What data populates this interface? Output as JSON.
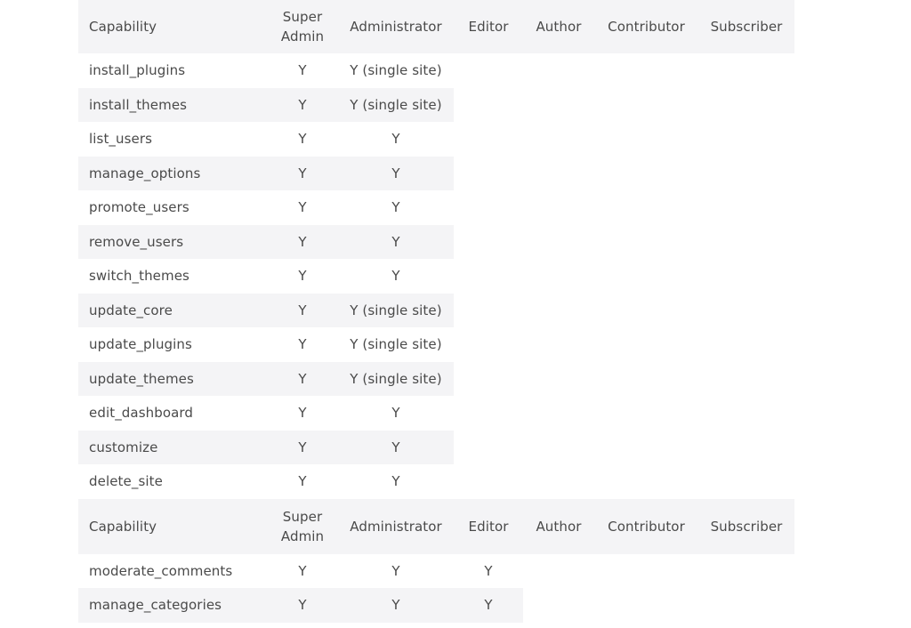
{
  "headers": [
    "Capability",
    "Super\nAdmin",
    "Administrator",
    "Editor",
    "Author",
    "Contributor",
    "Subscriber"
  ],
  "section1": {
    "rows": [
      {
        "cap": "install_plugins",
        "super_admin": "Y",
        "administrator": "Y (single site)"
      },
      {
        "cap": "install_themes",
        "super_admin": "Y",
        "administrator": "Y (single site)"
      },
      {
        "cap": "list_users",
        "super_admin": "Y",
        "administrator": "Y"
      },
      {
        "cap": "manage_options",
        "super_admin": "Y",
        "administrator": "Y"
      },
      {
        "cap": "promote_users",
        "super_admin": "Y",
        "administrator": "Y"
      },
      {
        "cap": "remove_users",
        "super_admin": "Y",
        "administrator": "Y"
      },
      {
        "cap": "switch_themes",
        "super_admin": "Y",
        "administrator": "Y"
      },
      {
        "cap": "update_core",
        "super_admin": "Y",
        "administrator": "Y (single site)"
      },
      {
        "cap": "update_plugins",
        "super_admin": "Y",
        "administrator": "Y (single site)"
      },
      {
        "cap": "update_themes",
        "super_admin": "Y",
        "administrator": "Y (single site)"
      },
      {
        "cap": "edit_dashboard",
        "super_admin": "Y",
        "administrator": "Y"
      },
      {
        "cap": "customize",
        "super_admin": "Y",
        "administrator": "Y"
      },
      {
        "cap": "delete_site",
        "super_admin": "Y",
        "administrator": "Y"
      }
    ]
  },
  "section2": {
    "rows": [
      {
        "cap": "moderate_comments",
        "super_admin": "Y",
        "administrator": "Y",
        "editor": "Y"
      },
      {
        "cap": "manage_categories",
        "super_admin": "Y",
        "administrator": "Y",
        "editor": "Y"
      }
    ]
  },
  "colors": {
    "header_bg": "#f4f4f6",
    "stripe_bg": "#f4f4f6",
    "text": "#4a4a4a"
  }
}
